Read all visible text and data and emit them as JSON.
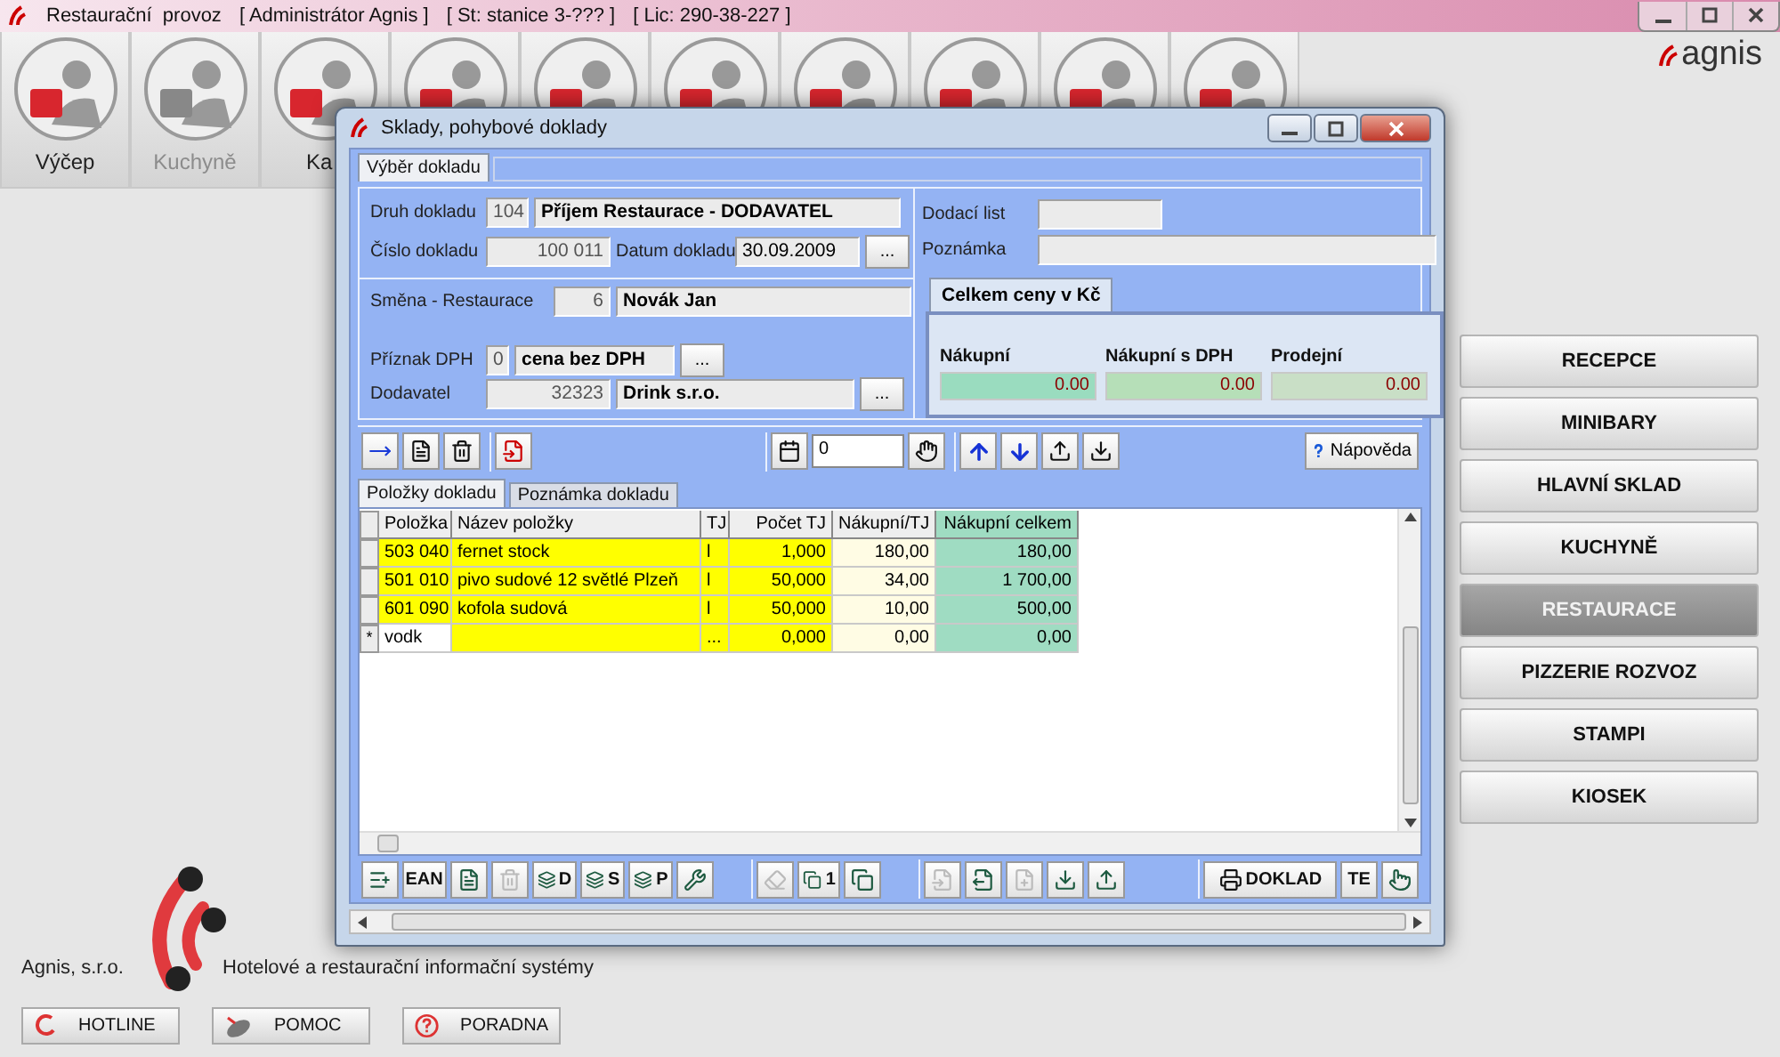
{
  "app_title_bar": {
    "title": "Restaurační  provoz",
    "user": "[ Administrátor Agnis ]",
    "station": "[ St: stanice 3-??? ]",
    "license": "[ Lic: 290-38-227 ]"
  },
  "modules": [
    {
      "label": "Výčep",
      "disabled": false
    },
    {
      "label": "Kuchyně",
      "disabled": true
    },
    {
      "label": "Ka",
      "disabled": false
    },
    {
      "disabled": false
    },
    {
      "disabled": false
    },
    {
      "disabled": false
    },
    {
      "disabled": false
    },
    {
      "disabled": false
    },
    {
      "disabled": false
    }
  ],
  "brand": "agnis",
  "side_menu": [
    {
      "label": "RECEPCE",
      "selected": false
    },
    {
      "label": "MINIBARY",
      "selected": false
    },
    {
      "label": "HLAVNÍ SKLAD",
      "selected": false
    },
    {
      "label": "KUCHYNĚ",
      "selected": false
    },
    {
      "label": "RESTAURACE",
      "selected": true
    },
    {
      "label": "PIZZERIE ROZVOZ",
      "selected": false
    },
    {
      "label": "STAMPI",
      "selected": false
    },
    {
      "label": "KIOSEK",
      "selected": false
    }
  ],
  "company": {
    "name": "Agnis, s.r.o.",
    "tagline": "Hotelové a restaurační informační systémy"
  },
  "footer_buttons": [
    {
      "label": "HOTLINE",
      "kind": "hotline"
    },
    {
      "label": "POMOC",
      "kind": "satellite"
    },
    {
      "label": "PORADNA",
      "kind": "question"
    }
  ],
  "dialog": {
    "title": "Sklady, pohybové doklady",
    "tabs": [
      {
        "label": "Výběr dokladu",
        "selected": true
      }
    ],
    "druh": {
      "label": "Druh dokladu",
      "code": "104",
      "value": "Příjem Restaurace - DODAVATEL"
    },
    "cislo": {
      "label": "Číslo dokladu",
      "code": "100 011",
      "date_label": "Datum dokladu",
      "date": "30.09.2009",
      "button": "..."
    },
    "smena": {
      "label": "Směna - Restaurace",
      "code": "6",
      "value": "Novák Jan"
    },
    "dph": {
      "label": "Příznak DPH",
      "code": "0",
      "value": "cena bez DPH",
      "button": "..."
    },
    "dodavatel": {
      "label": "Dodavatel",
      "code": "32323",
      "value": "Drink s.r.o.",
      "button": "..."
    },
    "dodaci_list": {
      "label": "Dodací list"
    },
    "poznamka": {
      "label": "Poznámka"
    },
    "totals_tab": "Celkem ceny v Kč",
    "totals": [
      {
        "label": "Nákupní",
        "value": "0.00",
        "color": "#9adcbf"
      },
      {
        "label": "Nákupní s DPH",
        "value": "0.00",
        "color": "#b6dfb8"
      },
      {
        "label": "Prodejní",
        "value": "0.00",
        "color": "#c9dfc6"
      }
    ],
    "counter": "0",
    "help_button": "Nápověda",
    "item_tabs": [
      {
        "label": "Položky dokladu",
        "selected": true
      },
      {
        "label": "Poznámka dokladu",
        "selected": false
      }
    ],
    "columns": [
      "Položka",
      "Název položky",
      "TJ",
      "Počet TJ",
      "Nákupní/TJ",
      "Nákupní celkem"
    ],
    "rows": [
      {
        "cells": [
          "503 040",
          "fernet stock",
          "l",
          "1,000",
          "180,00",
          "180,00"
        ]
      },
      {
        "cells": [
          "501 010",
          "pivo sudové 12 světlé Plzeň",
          "l",
          "50,000",
          "34,00",
          "1 700,00"
        ]
      },
      {
        "cells": [
          "601 090",
          "kofola sudová",
          "l",
          "50,000",
          "10,00",
          "500,00"
        ]
      }
    ],
    "new_row": {
      "marker": "*",
      "cells": [
        "vodk",
        "",
        "...",
        "0,000",
        "0,00",
        "0,00"
      ]
    },
    "bottom_tools": [
      {
        "kind": "icon",
        "disabled": false
      },
      {
        "kind": "text",
        "label": "EAN",
        "disabled": false
      },
      {
        "kind": "icon",
        "disabled": false
      },
      {
        "kind": "icon",
        "disabled": true
      },
      {
        "kind": "icon-text",
        "label": "D",
        "disabled": false
      },
      {
        "kind": "icon-text",
        "label": "S",
        "disabled": false
      },
      {
        "kind": "icon-text",
        "label": "P",
        "disabled": false
      },
      {
        "kind": "icon",
        "disabled": false
      },
      {
        "kind": "gap"
      },
      {
        "kind": "icon",
        "disabled": true
      },
      {
        "kind": "icon-text",
        "label": "1",
        "disabled": false
      },
      {
        "kind": "icon",
        "disabled": false
      },
      {
        "kind": "gap"
      },
      {
        "kind": "icon",
        "disabled": true
      },
      {
        "kind": "icon",
        "disabled": false
      },
      {
        "kind": "icon",
        "disabled": true
      },
      {
        "kind": "icon",
        "disabled": false
      },
      {
        "kind": "icon",
        "disabled": false
      },
      {
        "kind": "gap"
      },
      {
        "kind": "print",
        "label": "DOKLAD",
        "disabled": false
      },
      {
        "kind": "text",
        "label": "TE",
        "disabled": false
      },
      {
        "kind": "icon",
        "disabled": false
      }
    ]
  }
}
